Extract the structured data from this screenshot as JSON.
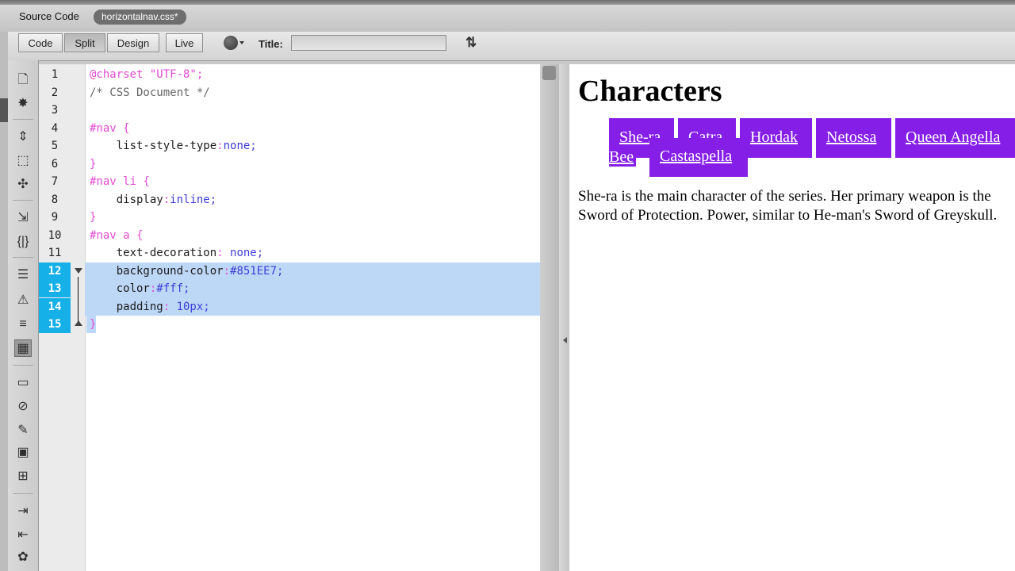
{
  "tabbar": {
    "source_label": "Source Code",
    "file_tab": "horizontalnav.css*"
  },
  "toolbar": {
    "view_buttons": [
      "Code",
      "Split",
      "Design",
      "Live"
    ],
    "active_view": "Split",
    "title_label": "Title:",
    "title_value": ""
  },
  "side_toolbar": {
    "icons": [
      "open-document-icon",
      "asset-icon",
      "collapse-full-tag-icon",
      "collapse-selection-icon",
      "expand-all-icon",
      "select-parent-tag-icon",
      "balance-braces-icon",
      "line-numbers-icon",
      "highlight-invalid-code-icon",
      "word-wrap-icon",
      "syntax-coloring-icon",
      "apply-comment-icon",
      "remove-comment-icon",
      "wrap-tag-icon",
      "recent-snippets-icon",
      "move-css-icon",
      "indent-code-icon",
      "outdent-code-icon",
      "format-source-code-icon"
    ]
  },
  "editor": {
    "line_numbers": [
      "1",
      "2",
      "3",
      "4",
      "5",
      "6",
      "7",
      "8",
      "9",
      "10",
      "11",
      "12",
      "13",
      "14",
      "15"
    ],
    "highlighted_lines": [
      12,
      13,
      14,
      15
    ],
    "lines": [
      [
        {
          "t": "@charset \"UTF-8\";",
          "c": "c-at"
        }
      ],
      [
        {
          "t": "/* CSS Document */",
          "c": "c-com"
        }
      ],
      [],
      [
        {
          "t": "#nav {",
          "c": "c-sel"
        }
      ],
      [
        {
          "t": "    list-style-type",
          "c": "c-prop"
        },
        {
          "t": ":",
          "c": "c-colon"
        },
        {
          "t": "none;",
          "c": "c-val"
        }
      ],
      [
        {
          "t": "}",
          "c": "c-sel"
        }
      ],
      [
        {
          "t": "#nav li {",
          "c": "c-sel"
        }
      ],
      [
        {
          "t": "    display",
          "c": "c-prop"
        },
        {
          "t": ":",
          "c": "c-colon"
        },
        {
          "t": "inline;",
          "c": "c-val"
        }
      ],
      [
        {
          "t": "}",
          "c": "c-sel"
        }
      ],
      [
        {
          "t": "#nav a {",
          "c": "c-sel"
        }
      ],
      [
        {
          "t": "    text-decoration",
          "c": "c-prop"
        },
        {
          "t": ": ",
          "c": "c-colon"
        },
        {
          "t": "none;",
          "c": "c-val"
        }
      ],
      [
        {
          "t": "    background-color",
          "c": "c-prop"
        },
        {
          "t": ":",
          "c": "c-colon"
        },
        {
          "t": "#851EE7;",
          "c": "c-val"
        }
      ],
      [
        {
          "t": "    color",
          "c": "c-prop"
        },
        {
          "t": ":",
          "c": "c-colon"
        },
        {
          "t": "#fff;",
          "c": "c-val"
        }
      ],
      [
        {
          "t": "    padding",
          "c": "c-prop"
        },
        {
          "t": ": ",
          "c": "c-colon"
        },
        {
          "t": "10px;",
          "c": "c-val"
        }
      ],
      [
        {
          "t": "}",
          "c": "c-sel"
        }
      ]
    ]
  },
  "preview": {
    "heading": "Characters",
    "nav_color": "#851EE7",
    "nav_items": [
      "She-ra",
      "Catra",
      "Hordak",
      "Netossa",
      "Queen Angella",
      "Castaspella"
    ],
    "nav_wrap_fragment": "Bee",
    "paragraph": "She-ra is the main character of the series. Her primary weapon is the Sword of Protection. Power, similar to He-man's Sword of Greyskull."
  }
}
